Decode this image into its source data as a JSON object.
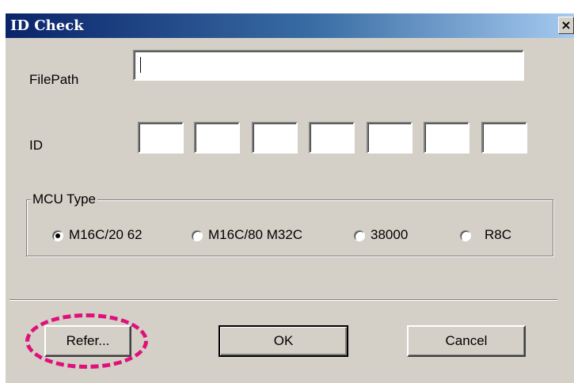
{
  "window": {
    "title": "ID Check",
    "close_glyph": "×"
  },
  "form": {
    "filepath_label": "FilePath",
    "filepath_value": "",
    "id_label": "ID",
    "id_values": [
      "",
      "",
      "",
      "",
      "",
      "",
      ""
    ]
  },
  "mcu_type": {
    "legend": "MCU Type",
    "options": [
      {
        "label": "M16C/20 62",
        "checked": true
      },
      {
        "label": "M16C/80 M32C",
        "checked": false
      },
      {
        "label": "38000",
        "checked": false
      },
      {
        "label": "R8C",
        "checked": false
      }
    ]
  },
  "buttons": {
    "refer_label": "Refer...",
    "ok_label": "OK",
    "cancel_label": "Cancel"
  },
  "annotation": {
    "highlight_color": "#e0107a",
    "highlight_style": "dashed ellipse"
  },
  "colors": {
    "dialog_face": "#d4d0c8",
    "titlebar_start": "#0a246a",
    "titlebar_end": "#a6caf0"
  }
}
